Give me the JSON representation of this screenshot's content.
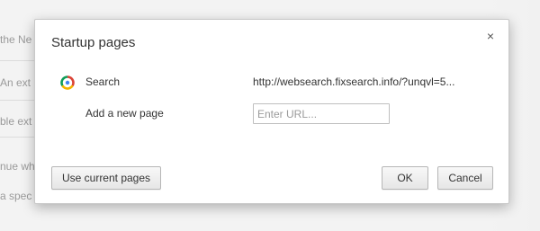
{
  "background": {
    "fragments": [
      "the Ne",
      "An ext",
      "ble ext",
      "nue wh",
      "a spec"
    ]
  },
  "dialog": {
    "title": "Startup pages",
    "close_glyph": "×",
    "rows": [
      {
        "icon": "chrome-icon",
        "label": "Search",
        "url": "http://websearch.fixsearch.info/?unqvl=5..."
      },
      {
        "label": "Add a new page",
        "input_placeholder": "Enter URL...",
        "input_value": ""
      }
    ],
    "buttons": {
      "use_current": "Use current pages",
      "ok": "OK",
      "cancel": "Cancel"
    }
  },
  "colors": {
    "dialog_bg": "#ffffff",
    "text": "#333333",
    "border": "#c8c8c8"
  }
}
